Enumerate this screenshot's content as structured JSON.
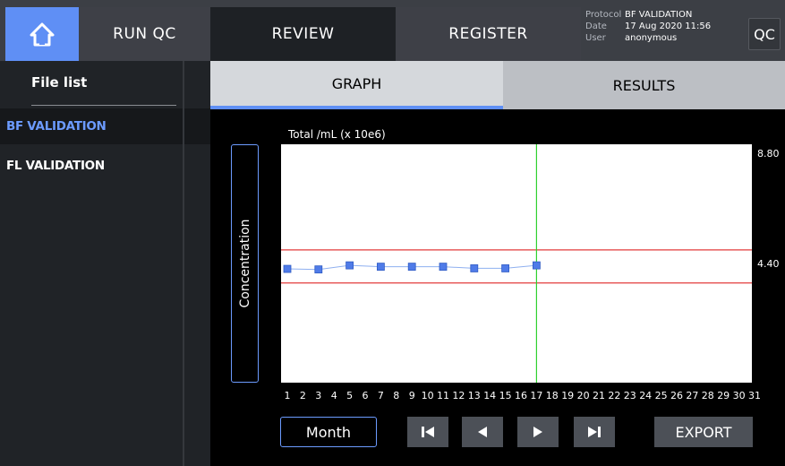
{
  "nav": {
    "home_icon": "home-icon",
    "run_qc": "RUN QC",
    "review": "REVIEW",
    "register": "REGISTER",
    "qc_button": "QC"
  },
  "info": {
    "protocol_label": "Protocol",
    "protocol_value": "BF VALIDATION",
    "date_label": "Date",
    "date_value": "17 Aug 2020 11:56",
    "user_label": "User",
    "user_value": "anonymous"
  },
  "sidebar": {
    "title": "File list",
    "items": [
      {
        "label": "BF VALIDATION",
        "active": true
      },
      {
        "label": "FL VALIDATION",
        "active": false
      }
    ]
  },
  "tabs": {
    "graph": "GRAPH",
    "results": "RESULTS"
  },
  "chart_side_label": "Concentration",
  "controls": {
    "month": "Month",
    "first_icon": "skip-first-icon",
    "prev_icon": "prev-icon",
    "next_icon": "next-icon",
    "last_icon": "skip-last-icon",
    "export": "EXPORT"
  },
  "colors": {
    "accent": "#5f8ff5",
    "point": "#4f7be8",
    "limit_line": "#e33b3b",
    "cursor_line": "#2ed12e"
  },
  "chart_data": {
    "type": "line",
    "title": "Total /mL (x 10e6)",
    "ylabel": "Concentration",
    "xlabel": "",
    "x_ticks": [
      "1",
      "2",
      "3",
      "4",
      "5",
      "6",
      "7",
      "8",
      "9",
      "10",
      "11",
      "12",
      "13",
      "14",
      "15",
      "16",
      "17",
      "18",
      "19",
      "20",
      "21",
      "22",
      "23",
      "24",
      "25",
      "26",
      "27",
      "28",
      "29",
      "30",
      "31"
    ],
    "y_tick_labels": [
      "8.80",
      "4.40"
    ],
    "ylim": [
      0,
      8.8
    ],
    "series": [
      {
        "values": [
          {
            "x": 1,
            "y": 4.2
          },
          {
            "x": 3,
            "y": 4.18
          },
          {
            "x": 5,
            "y": 4.33
          },
          {
            "x": 7,
            "y": 4.28
          },
          {
            "x": 9,
            "y": 4.28
          },
          {
            "x": 11,
            "y": 4.28
          },
          {
            "x": 13,
            "y": 4.22
          },
          {
            "x": 15,
            "y": 4.22
          },
          {
            "x": 17,
            "y": 4.33
          }
        ]
      }
    ],
    "limits": [
      4.9,
      3.68
    ],
    "cursor_x": 17,
    "grid": false
  }
}
